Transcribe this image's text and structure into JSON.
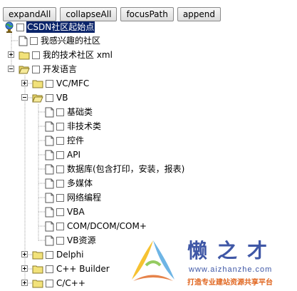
{
  "toolbar": {
    "expand_all": "expandAll",
    "collapse_all": "collapseAll",
    "focus_path": "focusPath",
    "append": "append"
  },
  "tree": {
    "root": "CSDN社区起始点",
    "items": [
      "我感兴趣的社区",
      "我的技术社区 xml",
      "开发语言",
      "VC/MFC",
      "VB",
      "基础类",
      "非技术类",
      "控件",
      "API",
      "数据库(包含打印，安装，报表)",
      "多媒体",
      "网络编程",
      "VBA",
      "COM/DCOM/COM+",
      "VB资源",
      "Delphi",
      "C++ Builder",
      "C/C++"
    ]
  },
  "watermark": {
    "title": "懒之才",
    "url": "www.aizhanzhe.com",
    "slogan": "打造专业建站资源共享平台"
  },
  "colors": {
    "selection": "#0a246a",
    "folder": "#f2e27a",
    "watermark_blue": "#3f57a6",
    "watermark_orange": "#e0651e"
  }
}
